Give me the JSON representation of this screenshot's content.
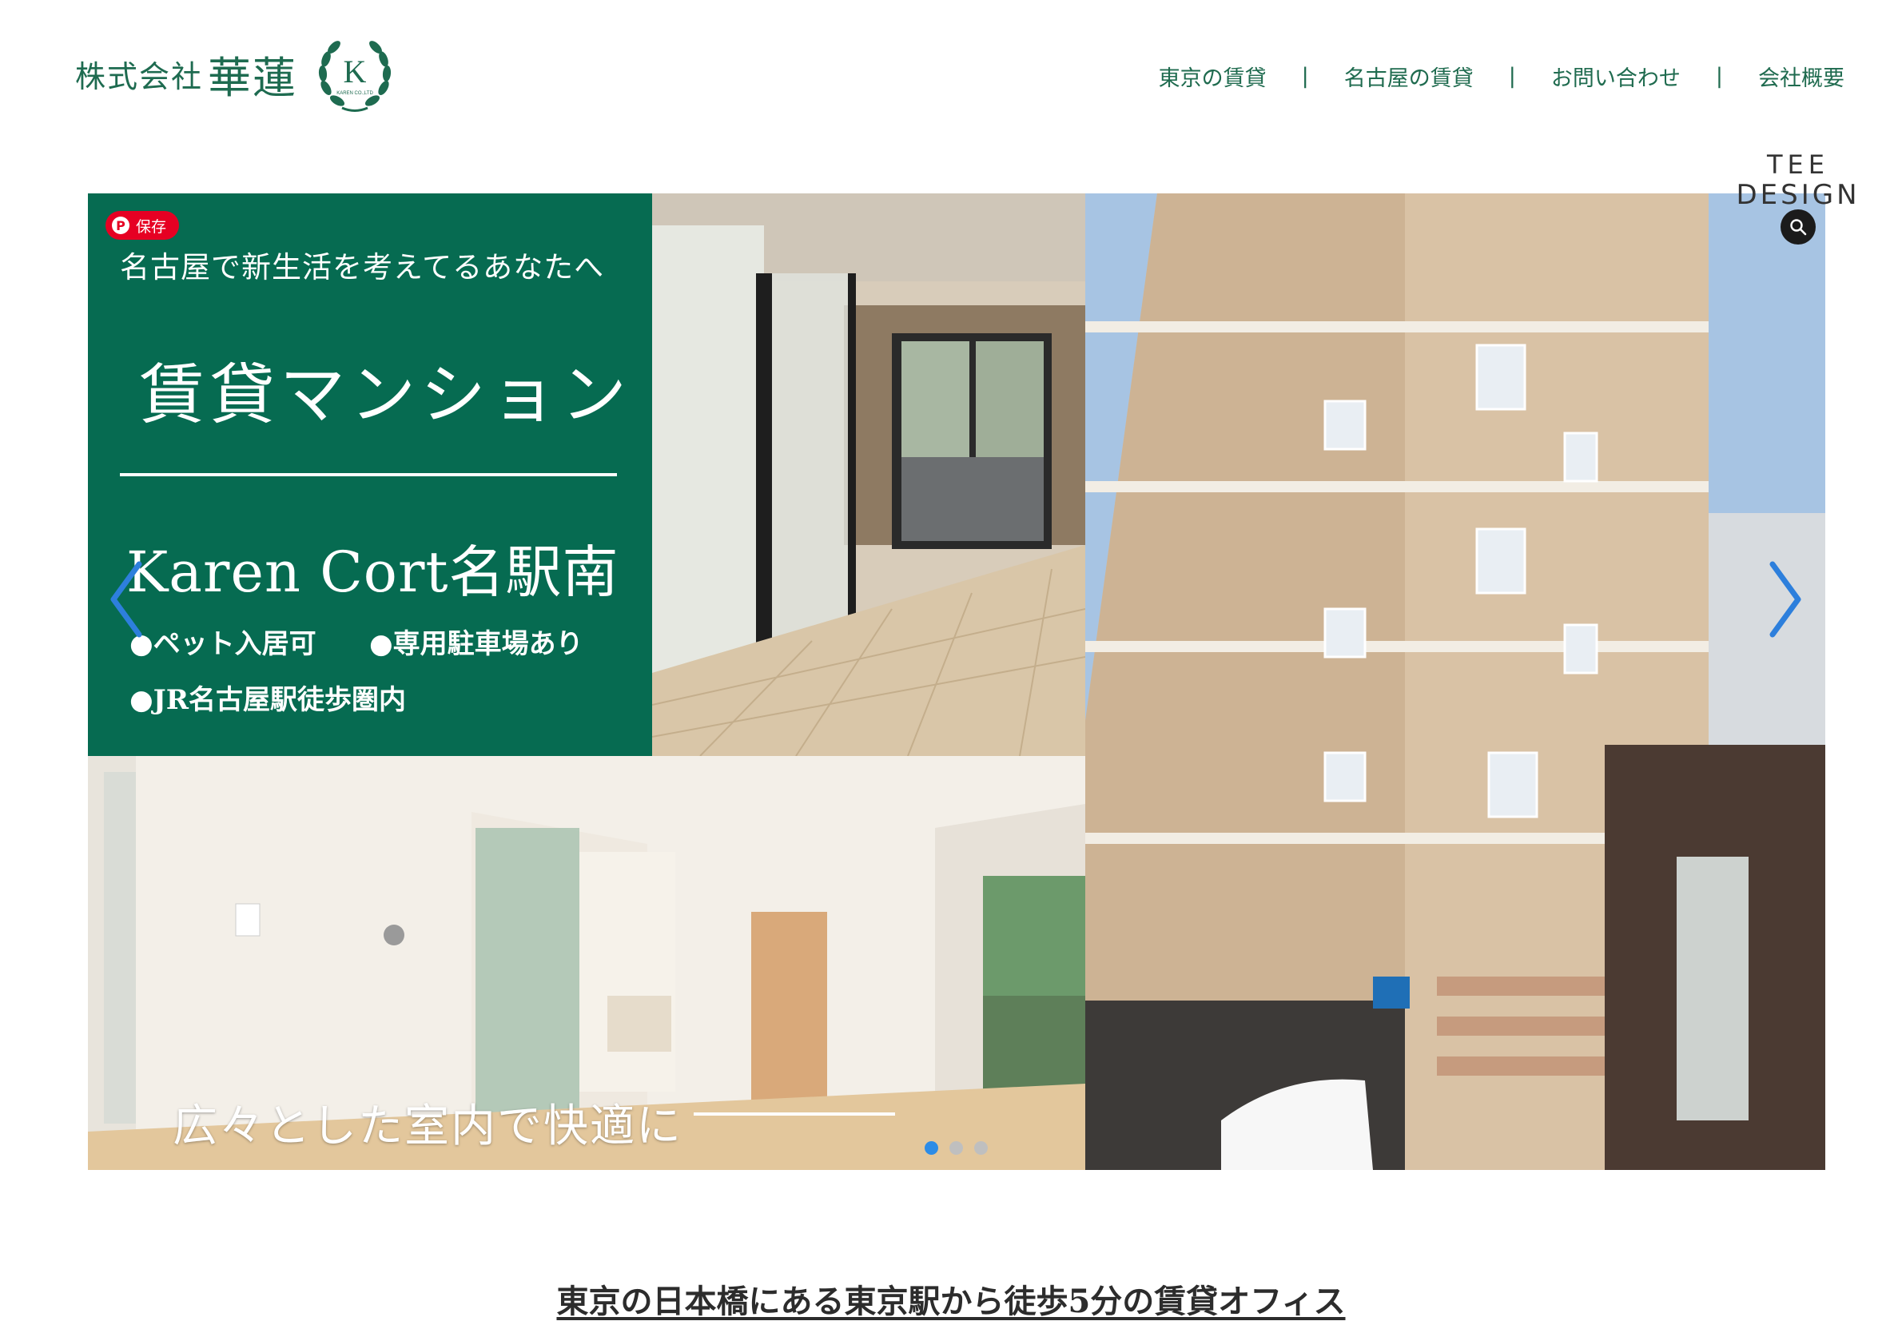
{
  "logo": {
    "prefix": "株式会社",
    "name": "華蓮",
    "emblem_letter": "K",
    "emblem_small": "KAREN CO.,LTD"
  },
  "nav": {
    "items": [
      {
        "label": "東京の賃貸"
      },
      {
        "label": "名古屋の賃貸"
      },
      {
        "label": "お問い合わせ"
      },
      {
        "label": "会社概要"
      }
    ],
    "separator": "|"
  },
  "badge": {
    "line1": "TEE",
    "line2": "DESIGN"
  },
  "slide": {
    "subtitle": "名古屋で新生活を考えてるあなたへ",
    "title": "賃貸マンション",
    "property_name": "Karen Cort名駅南",
    "features": [
      "●ペット入居可",
      "●専用駐車場あり",
      "●JR名古屋駅徒歩圏内"
    ],
    "caption": "広々とした室内で快適に",
    "save_label": "保存",
    "pin_glyph": "P",
    "total_slides": 3,
    "active_slide": 1
  },
  "colors": {
    "brand_green": "#066b51",
    "nav_green": "#1f6b4f",
    "pinterest_red": "#e60023",
    "dot_active": "#2d8ce6"
  },
  "bottom_heading": "東京の日本橋にある東京駅から徒歩5分の賃貸オフィス"
}
